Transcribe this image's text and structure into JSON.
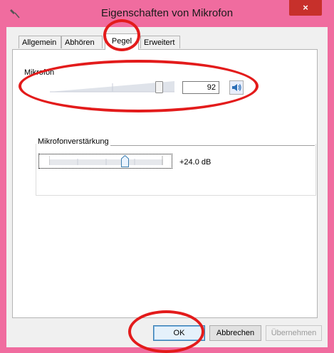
{
  "window": {
    "title": "Eigenschaften von Mikrofon",
    "title_icon": "microphone-icon",
    "close_label": "×"
  },
  "tabs": [
    {
      "label": "Allgemein",
      "active": false
    },
    {
      "label": "Abhören",
      "active": false
    },
    {
      "label": "Pegel",
      "active": true
    },
    {
      "label": "Erweitert",
      "active": false
    }
  ],
  "mikrofon": {
    "label": "Mikrofon",
    "level": 92,
    "value_text": "92",
    "speaker_icon": "speaker-icon"
  },
  "boost": {
    "label": "Mikrofonverstärkung",
    "value_text": "+24.0 dB",
    "level_fraction": 0.8
  },
  "buttons": {
    "ok": "OK",
    "cancel": "Abbrechen",
    "apply": "Übernehmen"
  },
  "colors": {
    "frame": "#f06c9f",
    "close": "#c7302b",
    "annotation": "#e31b1b"
  }
}
